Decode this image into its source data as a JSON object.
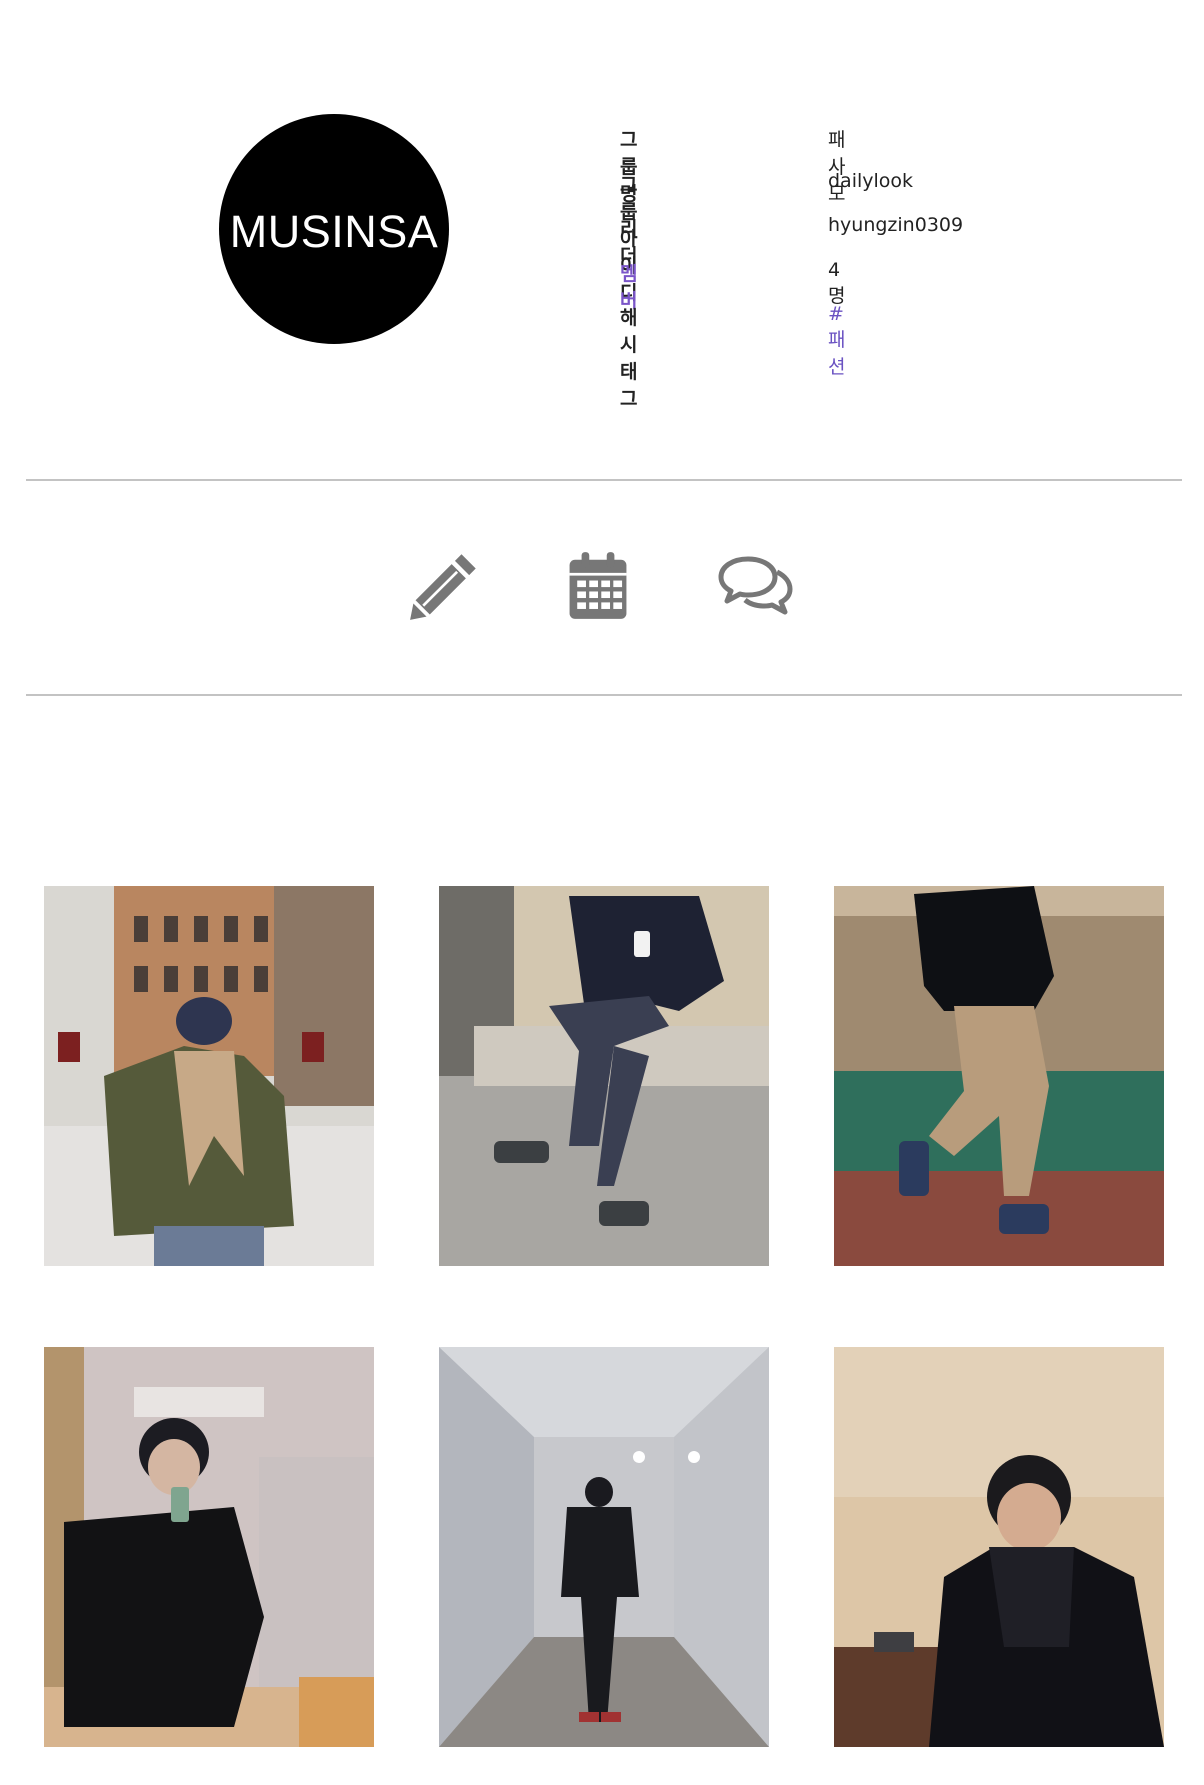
{
  "group": {
    "logo_text": "MUSINSA",
    "fields": [
      {
        "label": "그룹명",
        "value": "패사모"
      },
      {
        "label": "그룹 아이디",
        "value": "dailylook"
      },
      {
        "label": "리더",
        "value": "hyungzin0309"
      },
      {
        "label": "멤버",
        "value": "4명"
      },
      {
        "label": "해시태그",
        "value": "#패션"
      }
    ]
  },
  "tabs": [
    {
      "icon": "pencil-icon"
    },
    {
      "icon": "calendar-icon"
    },
    {
      "icon": "comments-icon"
    }
  ],
  "photos": [
    {
      "icon": "photo-snowy-street"
    },
    {
      "icon": "photo-sitting-bench"
    },
    {
      "icon": "photo-walking-track"
    },
    {
      "icon": "photo-mirror-selfie"
    },
    {
      "icon": "photo-hallway"
    },
    {
      "icon": "photo-portrait-scarf"
    }
  ],
  "colors": {
    "purple_label": "#7a55c8",
    "hashtag": "#6a52c2",
    "icon_gray": "#777777",
    "divider": "#c3c3c3"
  }
}
